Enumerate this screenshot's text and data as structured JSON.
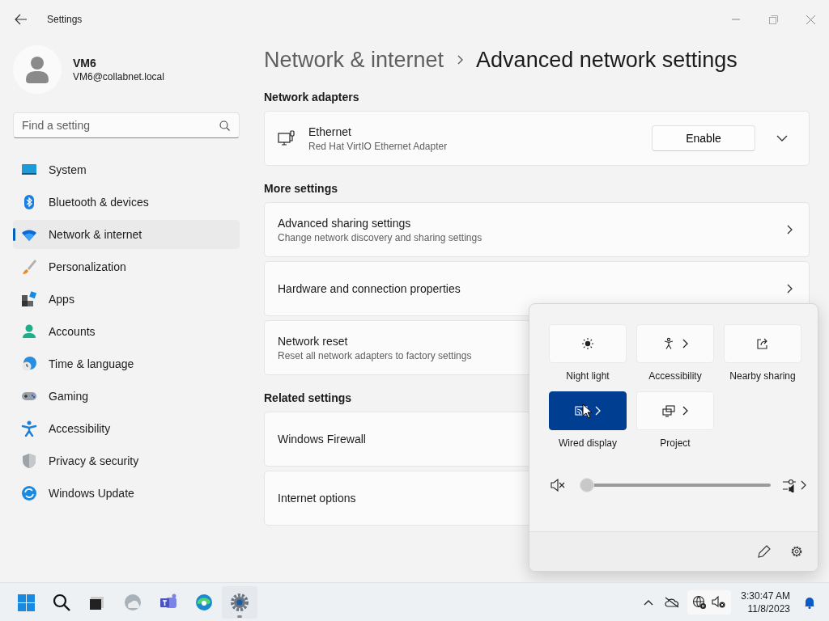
{
  "window": {
    "title": "Settings"
  },
  "profile": {
    "name": "VM6",
    "email": "VM6@collabnet.local"
  },
  "search": {
    "placeholder": "Find a setting"
  },
  "sidebar": {
    "items": [
      {
        "label": "System",
        "selected": false
      },
      {
        "label": "Bluetooth & devices",
        "selected": false
      },
      {
        "label": "Network & internet",
        "selected": true
      },
      {
        "label": "Personalization",
        "selected": false
      },
      {
        "label": "Apps",
        "selected": false
      },
      {
        "label": "Accounts",
        "selected": false
      },
      {
        "label": "Time & language",
        "selected": false
      },
      {
        "label": "Gaming",
        "selected": false
      },
      {
        "label": "Accessibility",
        "selected": false
      },
      {
        "label": "Privacy & security",
        "selected": false
      },
      {
        "label": "Windows Update",
        "selected": false
      }
    ]
  },
  "breadcrumb": {
    "parent": "Network & internet",
    "current": "Advanced network settings"
  },
  "sections": [
    {
      "heading": "Network adapters",
      "cards": [
        {
          "kind": "adapter",
          "title": "Ethernet",
          "subtitle": "Red Hat VirtIO Ethernet Adapter",
          "button": "Enable",
          "expanded": false
        }
      ]
    },
    {
      "heading": "More settings",
      "cards": [
        {
          "kind": "link",
          "title": "Advanced sharing settings",
          "subtitle": "Change network discovery and sharing settings",
          "chevron": true
        },
        {
          "kind": "link",
          "title": "Hardware and connection properties",
          "chevron": true
        },
        {
          "kind": "link",
          "title": "Network reset",
          "subtitle": "Reset all network adapters to factory settings",
          "chevron": false
        }
      ]
    },
    {
      "heading": "Related settings",
      "cards": [
        {
          "kind": "link",
          "title": "Windows Firewall",
          "chevron": false
        },
        {
          "kind": "link",
          "title": "Internet options",
          "chevron": false
        }
      ]
    }
  ],
  "quick_settings": {
    "tiles": [
      {
        "label": "Night light",
        "on": false,
        "chevron": false
      },
      {
        "label": "Accessibility",
        "on": false,
        "chevron": true
      },
      {
        "label": "Nearby sharing",
        "on": false,
        "chevron": false
      },
      {
        "label": "Wired display",
        "on": true,
        "chevron": true
      },
      {
        "label": "Project",
        "on": false,
        "chevron": true
      }
    ],
    "volume": {
      "muted": true,
      "level": 0
    }
  },
  "taskbar": {
    "apps": [
      {
        "running": false
      },
      {
        "running": false
      },
      {
        "running": false
      },
      {
        "running": false
      },
      {
        "running": false
      },
      {
        "running": false
      },
      {
        "running": true
      }
    ],
    "time": "3:30:47 AM",
    "date": "11/8/2023"
  }
}
